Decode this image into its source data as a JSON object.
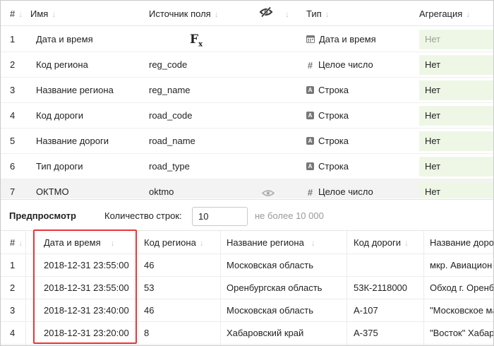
{
  "fields": {
    "headers": {
      "num": "#",
      "name": "Имя",
      "source": "Источник поля",
      "type": "Тип",
      "aggregation": "Агрегация"
    },
    "formula_label": "F",
    "formula_sub": "x",
    "rows": [
      {
        "num": "1",
        "name": "Дата и время",
        "source": "",
        "type_icon": "calendar-icon",
        "type": "Дата и время",
        "aggregation": "Нет"
      },
      {
        "num": "2",
        "name": "Код региона",
        "source": "reg_code",
        "type_icon": "hash-icon",
        "type": "Целое число",
        "aggregation": "Нет"
      },
      {
        "num": "3",
        "name": "Название региона",
        "source": "reg_name",
        "type_icon": "string-icon",
        "type": "Строка",
        "aggregation": "Нет"
      },
      {
        "num": "4",
        "name": "Код дороги",
        "source": "road_code",
        "type_icon": "string-icon",
        "type": "Строка",
        "aggregation": "Нет"
      },
      {
        "num": "5",
        "name": "Название дороги",
        "source": "road_name",
        "type_icon": "string-icon",
        "type": "Строка",
        "aggregation": "Нет"
      },
      {
        "num": "6",
        "name": "Тип дороги",
        "source": "road_type",
        "type_icon": "string-icon",
        "type": "Строка",
        "aggregation": "Нет"
      },
      {
        "num": "7",
        "name": "ОКТМО",
        "source": "oktmo",
        "type_icon": "hash-icon",
        "type": "Целое число",
        "aggregation": "Нет"
      }
    ]
  },
  "preview": {
    "title": "Предпросмотр",
    "rows_label": "Количество строк:",
    "rows_value": "10",
    "rows_hint": "не более 10 000",
    "columns": [
      "#",
      "Дата и время",
      "Код региона",
      "Название региона",
      "Код дороги",
      "Название доро"
    ],
    "rows": [
      [
        "1",
        "2018-12-31 23:55:00",
        "46",
        "Московская область",
        "",
        "мкр. Авиацион"
      ],
      [
        "2",
        "2018-12-31 23:55:00",
        "53",
        "Оренбургская область",
        "53К-2118000",
        "Обход г. Оренб"
      ],
      [
        "3",
        "2018-12-31 23:40:00",
        "46",
        "Московская область",
        "А-107",
        "\"Московское ма"
      ],
      [
        "4",
        "2018-12-31 23:20:00",
        "8",
        "Хабаровский край",
        "А-375",
        "\"Восток\" Хабар"
      ]
    ]
  },
  "colors": {
    "accent_highlight": "#e8363a",
    "aggregation_bg": "#eef7e6",
    "selected_row_bg": "#f3f3f3"
  }
}
